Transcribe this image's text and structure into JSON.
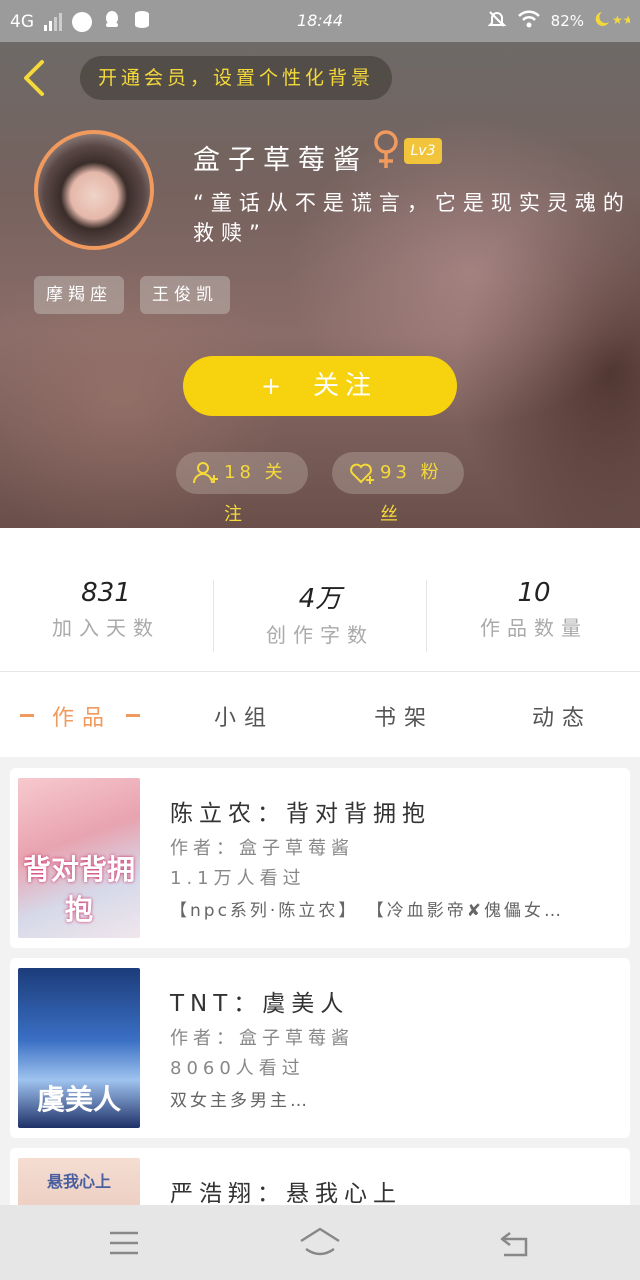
{
  "status_bar": {
    "network": "4G",
    "time": "18:44",
    "battery": "82%"
  },
  "header": {
    "tip": "开通会员，设置个性化背景"
  },
  "profile": {
    "username": "盒子草莓酱",
    "gender_icon": "female-symbol",
    "level": "Lv3",
    "signature": "“童话从不是谎言，它是现实灵魂的救赎”",
    "tags": [
      "摩羯座",
      "王俊凯"
    ],
    "follow_label": "关注",
    "following_text": "18 关注",
    "fans_text": "93 粉丝"
  },
  "stats": [
    {
      "value": "831",
      "label": "加入天数"
    },
    {
      "value": "4万",
      "label": "创作字数"
    },
    {
      "value": "10",
      "label": "作品数量"
    }
  ],
  "tabs": [
    {
      "label": "作品",
      "active": true
    },
    {
      "label": "小组",
      "active": false
    },
    {
      "label": "书架",
      "active": false
    },
    {
      "label": "动态",
      "active": false
    }
  ],
  "books": [
    {
      "title": "陈立农：背对背拥抱",
      "author": "作者：盒子草莓酱",
      "views": "1.1万人看过",
      "tags": "【npc系列·陈立农】 【冷血影帝✘傀儡女…",
      "cover_text": "背对背拥抱"
    },
    {
      "title": "TNT：虞美人",
      "author": "作者：盒子草莓酱",
      "views": "8060人看过",
      "tags": "双女主多男主…",
      "cover_text": "虞美人"
    },
    {
      "title": "严浩翔：悬我心上",
      "author": "",
      "views": "",
      "tags": "",
      "cover_text": "悬我心上"
    }
  ],
  "colors": {
    "accent": "#f09a5e",
    "follow": "#f7d20f",
    "highlight": "#f5d93b"
  }
}
